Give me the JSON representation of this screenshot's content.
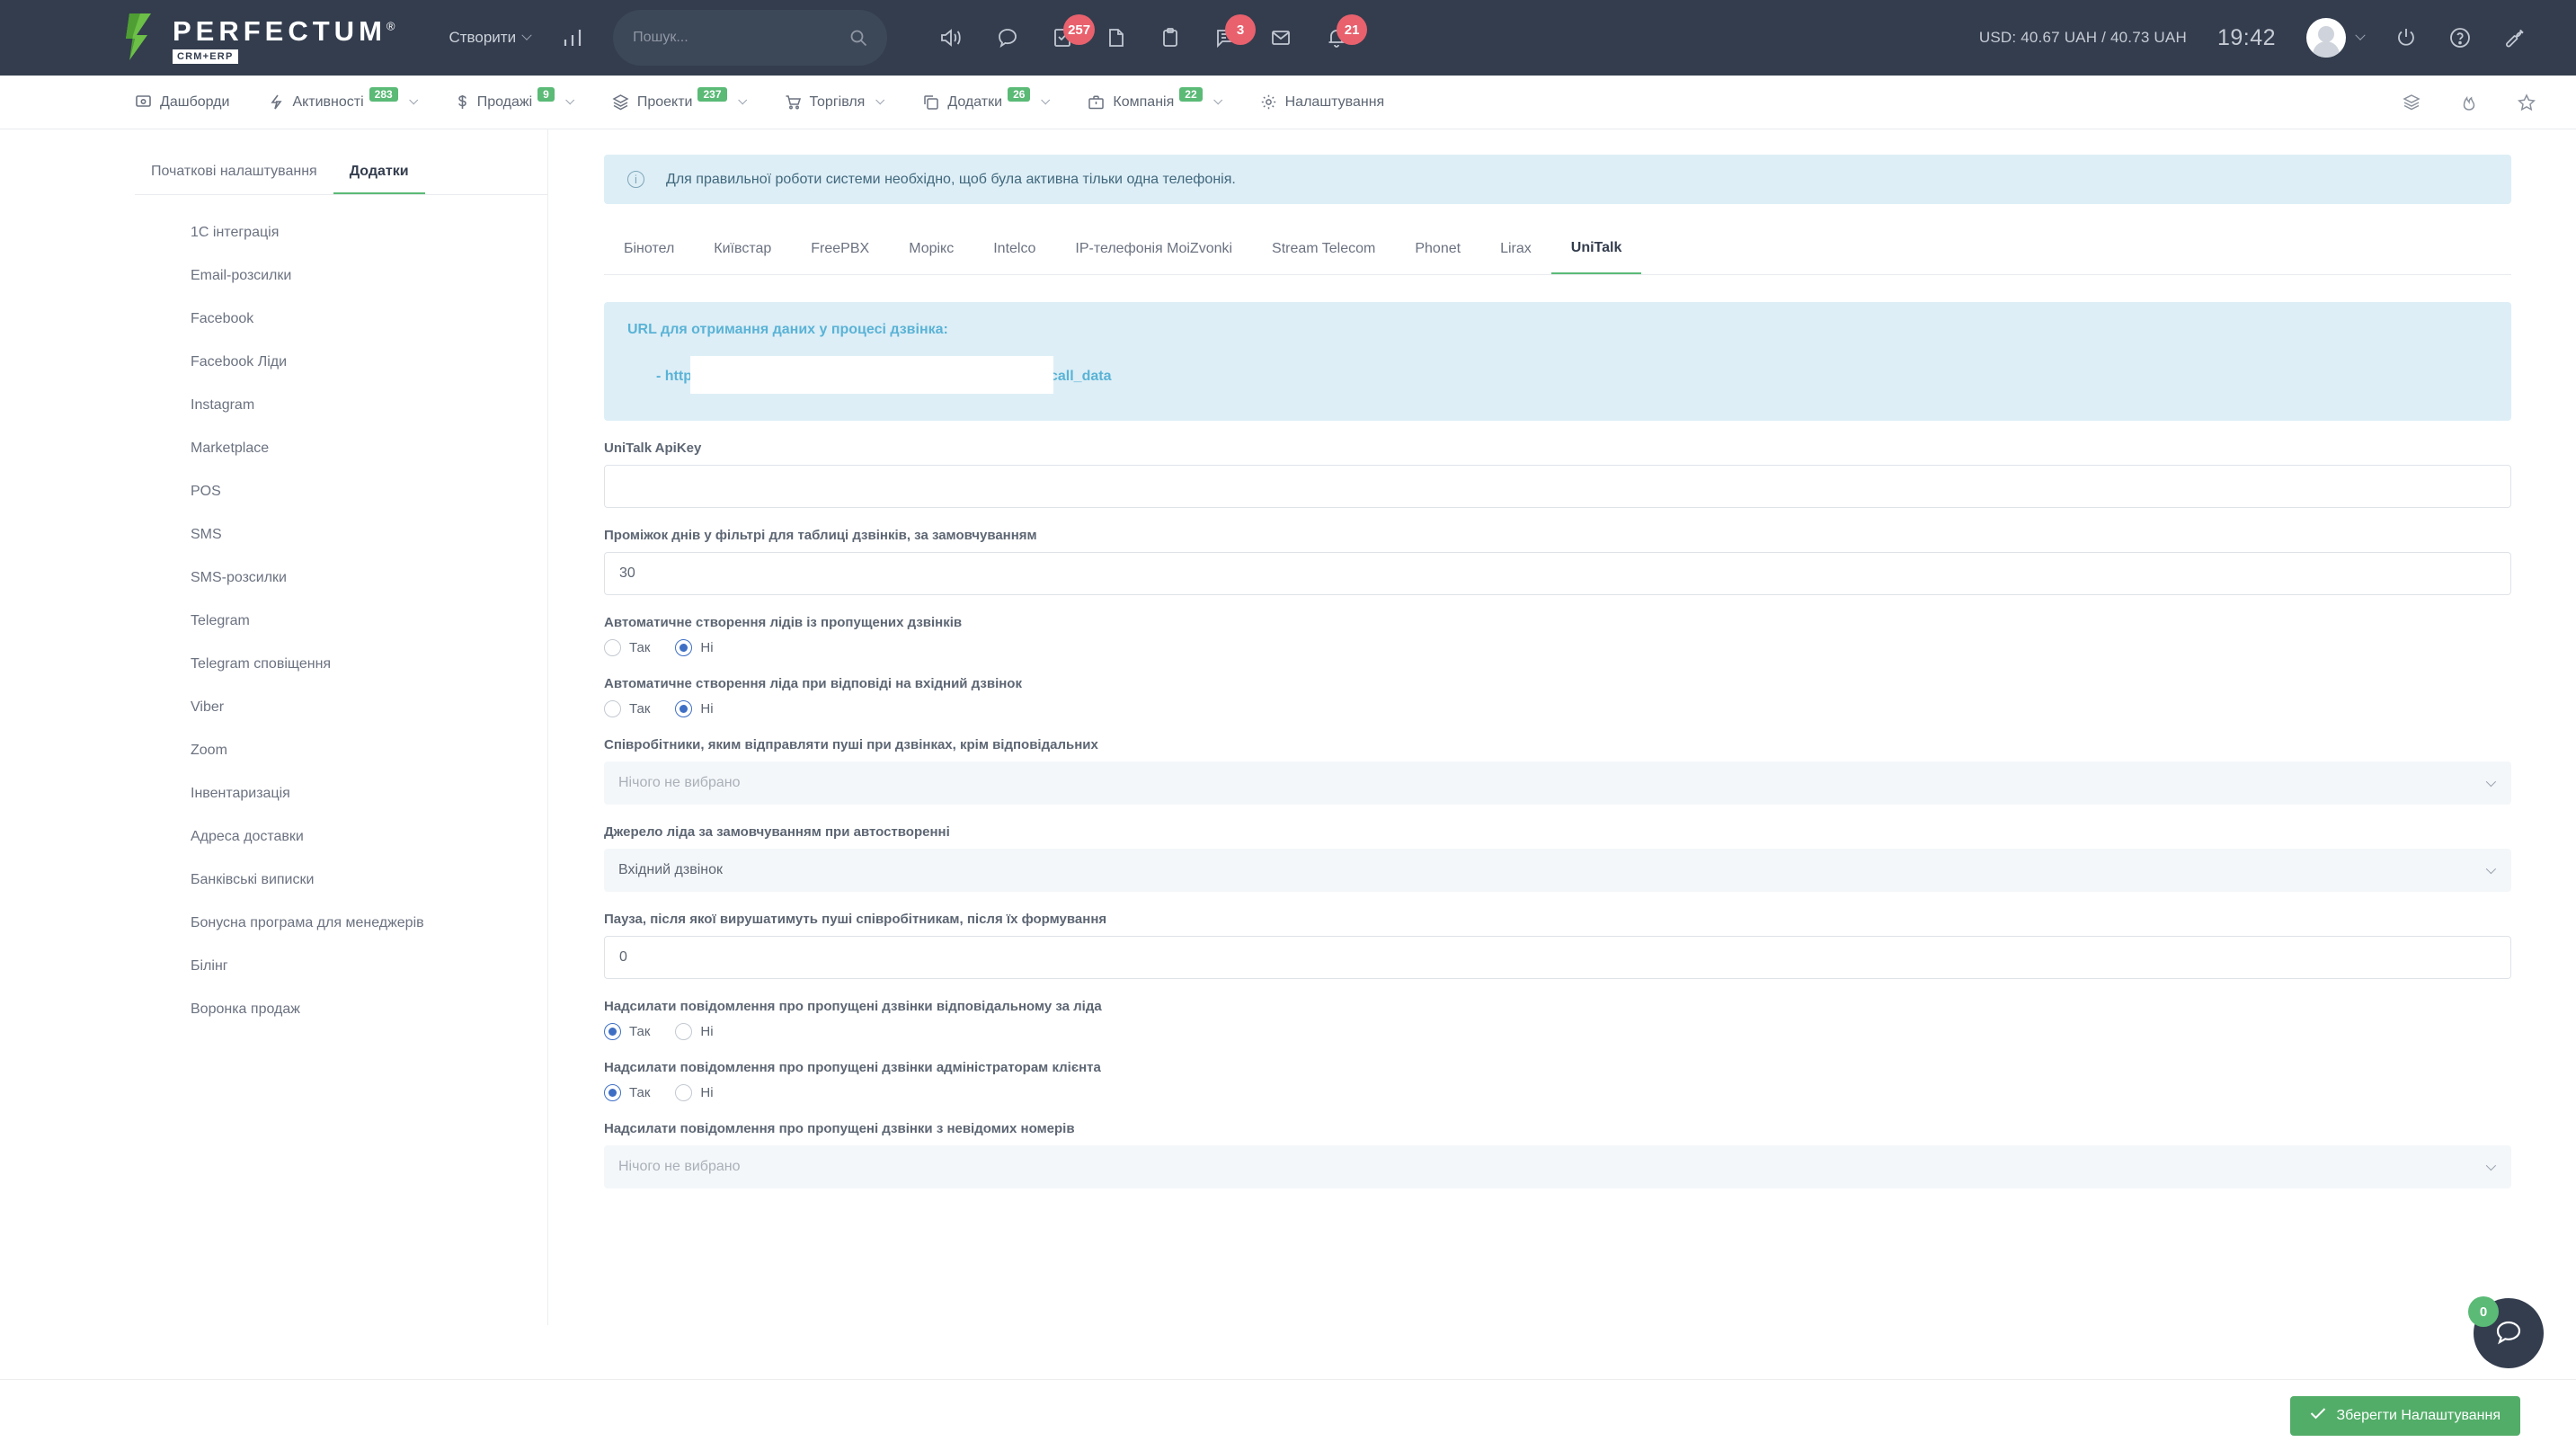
{
  "topbar": {
    "logo_word": "PERFECTUM",
    "logo_reg": "®",
    "logo_sub": "CRM+ERP",
    "create_label": "Створити",
    "search_placeholder": "Пошук...",
    "search_value": "",
    "icons": [
      {
        "name": "speaker-icon",
        "badge": null
      },
      {
        "name": "chat-bubble-icon",
        "badge": null
      },
      {
        "name": "task-check-icon",
        "badge": "257"
      },
      {
        "name": "document-icon",
        "badge": null
      },
      {
        "name": "clipboard-icon",
        "badge": null
      },
      {
        "name": "comment-icon",
        "badge": "3"
      },
      {
        "name": "mail-icon",
        "badge": null
      },
      {
        "name": "bell-icon",
        "badge": "21"
      }
    ],
    "currency_rate": "USD: 40.67 UAH / 40.73 UAH",
    "clock": "19:42",
    "right_icons": [
      "power-icon",
      "help-icon",
      "wrench-icon"
    ]
  },
  "nav": {
    "items": [
      {
        "label": "Дашборди",
        "icon": "dashboard-icon",
        "badge": null,
        "chevron": false
      },
      {
        "label": "Активності",
        "icon": "lightning-icon",
        "badge": "283",
        "chevron": true
      },
      {
        "label": "Продажі",
        "icon": "dollar-icon",
        "badge": "9",
        "chevron": true
      },
      {
        "label": "Проекти",
        "icon": "layers-icon",
        "badge": "237",
        "chevron": true
      },
      {
        "label": "Торгівля",
        "icon": "cart-icon",
        "badge": null,
        "chevron": true
      },
      {
        "label": "Додатки",
        "icon": "copy-icon",
        "badge": "26",
        "chevron": true
      },
      {
        "label": "Компанія",
        "icon": "briefcase-icon",
        "badge": "22",
        "chevron": true
      },
      {
        "label": "Налаштування",
        "icon": "gear-icon",
        "badge": null,
        "chevron": false
      }
    ],
    "right_icons": [
      "stack-icon",
      "fire-icon",
      "star-icon"
    ]
  },
  "sidebar": {
    "tabs": [
      {
        "label": "Початкові налаштування",
        "active": false
      },
      {
        "label": "Додатки",
        "active": true
      }
    ],
    "items": [
      "1C інтеграція",
      "Email-розсилки",
      "Facebook",
      "Facebook Ліди",
      "Instagram",
      "Marketplace",
      "POS",
      "SMS",
      "SMS-розсилки",
      "Telegram",
      "Telegram сповіщення",
      "Viber",
      "Zoom",
      "Інвентаризація",
      "Адреса доставки",
      "Банківські виписки",
      "Бонусна програма для менеджерів",
      "Білінг",
      "Воронка продаж"
    ]
  },
  "main": {
    "alert": "Для правильної роботи системи необхідно, щоб була активна тільки одна телефонія.",
    "telephony_tabs": [
      {
        "label": "Бінотел",
        "active": false
      },
      {
        "label": "Київстар",
        "active": false
      },
      {
        "label": "FreePBX",
        "active": false
      },
      {
        "label": "Морікс",
        "active": false
      },
      {
        "label": "Intelco",
        "active": false
      },
      {
        "label": "IP-телефонія MoiZvonki",
        "active": false
      },
      {
        "label": "Stream Telecom",
        "active": false
      },
      {
        "label": "Phonet",
        "active": false
      },
      {
        "label": "Lirax",
        "active": false
      },
      {
        "label": "UniTalk",
        "active": true
      }
    ],
    "url_block": {
      "title": "URL для отримання даних у процесі дзвінка:",
      "prefix": "- http",
      "suffix": "call_data"
    },
    "fields": [
      {
        "id": "apikey",
        "label": "UniTalk ApiKey",
        "type": "text",
        "value": "",
        "placeholder": ""
      },
      {
        "id": "days_range",
        "label": "Проміжок днів у фільтрі для таблиці дзвінків, за замовчуванням",
        "type": "text",
        "value": "30",
        "placeholder": ""
      },
      {
        "id": "auto_lead_missed",
        "label": "Автоматичне створення лідів із пропущених дзвінків",
        "type": "radio",
        "options": [
          "Так",
          "Ні"
        ],
        "selected": "Ні"
      },
      {
        "id": "auto_lead_answered",
        "label": "Автоматичне створення ліда при відповіді на вхідний дзвінок",
        "type": "radio",
        "options": [
          "Так",
          "Ні"
        ],
        "selected": "Ні"
      },
      {
        "id": "push_employees",
        "label": "Співробітники, яким відправляти пуші при дзвінках, крім відповідальних",
        "type": "select",
        "value": "Нічого не вибрано",
        "filled": false
      },
      {
        "id": "lead_source",
        "label": "Джерело ліда за замовчуванням при автостворенні",
        "type": "select",
        "value": "Вхідний дзвінок",
        "filled": true
      },
      {
        "id": "push_delay",
        "label": "Пауза, після якої вирушатимуть пуші співробітникам, після їх формування",
        "type": "text",
        "value": "0",
        "placeholder": ""
      },
      {
        "id": "notify_lead_owner",
        "label": "Надсилати повідомлення про пропущені дзвінки відповідальному за ліда",
        "type": "radio",
        "options": [
          "Так",
          "Ні"
        ],
        "selected": "Так"
      },
      {
        "id": "notify_client_admins",
        "label": "Надсилати повідомлення про пропущені дзвінки адміністраторам клієнта",
        "type": "radio",
        "options": [
          "Так",
          "Ні"
        ],
        "selected": "Так"
      },
      {
        "id": "notify_unknown_numbers",
        "label": "Надсилати повідомлення про пропущені дзвінки з невідомих номерів",
        "type": "select",
        "value": "Нічого не вибрано",
        "filled": false
      }
    ]
  },
  "footer": {
    "save_label": "Зберегти Налаштування"
  },
  "chat_widget": {
    "badge": "0"
  },
  "colors": {
    "topbar_bg": "#333d4e",
    "accent_green": "#5aba76",
    "save_green": "#52ad68",
    "badge_red": "#e8616d",
    "radio_blue": "#3f6fc4",
    "info_bg": "#ddeef6",
    "info_text": "#5ab3d6"
  }
}
